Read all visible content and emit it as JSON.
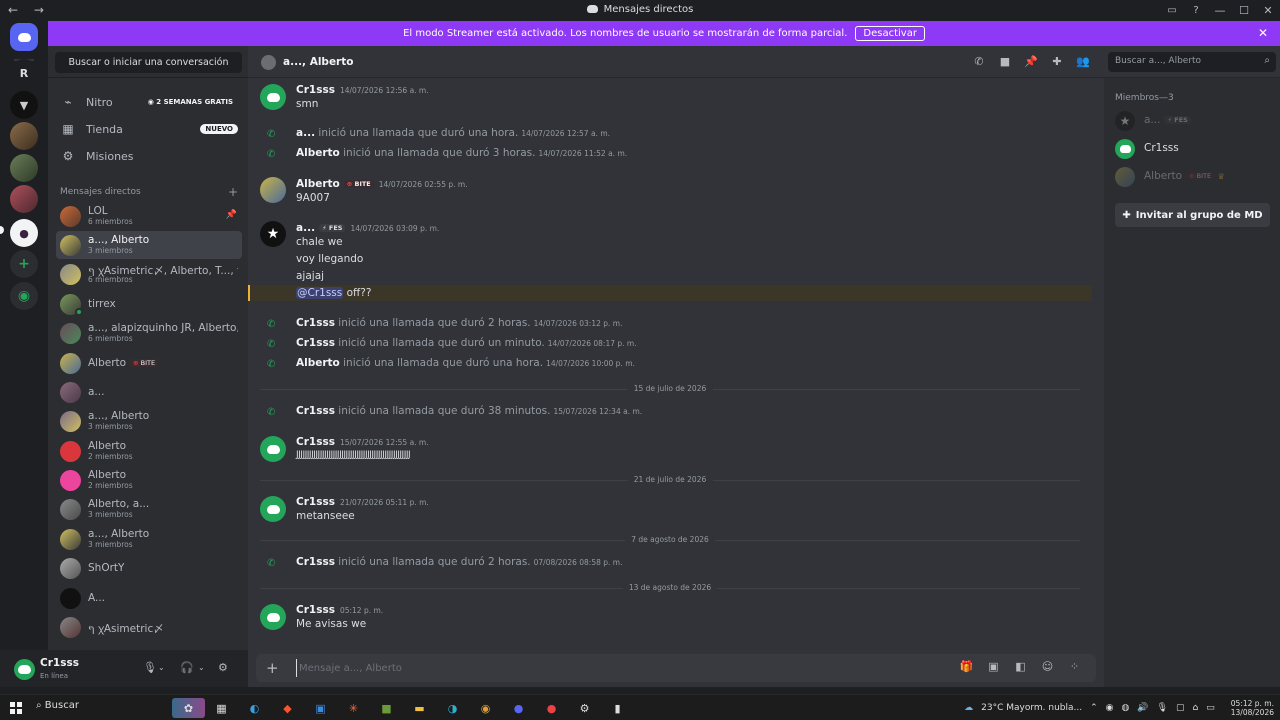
{
  "window": {
    "title": "Mensajes directos"
  },
  "banner": {
    "text": "El modo Streamer está activado. Los nombres de usuario se mostrarán de forma parcial.",
    "button": "Desactivar",
    "color": "#8e39f5"
  },
  "servers": {
    "letter": "R"
  },
  "sidebar": {
    "search_label": "Buscar o iniciar una conversación",
    "nitro": "Nitro",
    "nitro_badge": "2 SEMANAS GRATIS",
    "tienda": "Tienda",
    "tienda_badge": "NUEVO",
    "misiones": "Misiones",
    "section": "Mensajes directos",
    "dms": [
      {
        "name": "LOL",
        "sub": "6 miembros"
      },
      {
        "name": "a..., Alberto",
        "sub": "3 miembros"
      },
      {
        "name": "ף ꭓAsimetric〆, Alberto, T..., ti...",
        "sub": "6 miembros"
      },
      {
        "name": "tirrex",
        "sub": ""
      },
      {
        "name": "a..., alapizquinho JR, Alberto, a...",
        "sub": "6 miembros"
      },
      {
        "name": "Alberto",
        "sub": ""
      },
      {
        "name": "a...",
        "sub": ""
      },
      {
        "name": "a..., Alberto",
        "sub": "3 miembros"
      },
      {
        "name": "Alberto",
        "sub": "2 miembros"
      },
      {
        "name": "Alberto",
        "sub": "2 miembros"
      },
      {
        "name": "Alberto, a...",
        "sub": "3 miembros"
      },
      {
        "name": "a..., Alberto",
        "sub": "3 miembros"
      },
      {
        "name": "ShOrtY",
        "sub": ""
      },
      {
        "name": "A...",
        "sub": ""
      },
      {
        "name": "ף ꭓAsimetric〆",
        "sub": ""
      }
    ],
    "tag_bite": "BITE"
  },
  "user": {
    "name": "Cr1sss",
    "status": "En línea"
  },
  "header": {
    "title": "a..., Alberto",
    "search_placeholder": "Buscar a..., Alberto"
  },
  "messages": {
    "m1_author": "Cr1sss",
    "m1_ts": "14/07/2026 12:56 a. m.",
    "m1_text": "smn",
    "c1_name": "a...",
    "c1_text": "inició una llamada que duró una hora.",
    "c1_ts": "14/07/2026 12:57 a. m.",
    "c2_name": "Alberto",
    "c2_text": "inició una llamada que duró 3 horas.",
    "c2_ts": "14/07/2026 11:52 a. m.",
    "m2_author": "Alberto",
    "m2_tag": "BITE",
    "m2_ts": "14/07/2026 02:55 p. m.",
    "m2_text": "9A007",
    "m3_author": "a...",
    "m3_tag": "FES",
    "m3_ts": "14/07/2026 03:09 p. m.",
    "m3_l1": "chale we",
    "m3_l2": "voy llegando",
    "m3_l3": "ajajaj",
    "m3_mention": "@Cr1sss",
    "m3_l4": "off??",
    "c3_name": "Cr1sss",
    "c3_text": "inició una llamada que duró 2 horas.",
    "c3_ts": "14/07/2026 03:12 p. m.",
    "c4_name": "Cr1sss",
    "c4_text": "inició una llamada que duró un minuto.",
    "c4_ts": "14/07/2026 08:17 p. m.",
    "c5_name": "Alberto",
    "c5_text": "inició una llamada que duró una hora.",
    "c5_ts": "14/07/2026 10:00 p. m.",
    "d1": "15 de julio de 2026",
    "c6_name": "Cr1sss",
    "c6_text": "inició una llamada que duró 38 minutos.",
    "c6_ts": "15/07/2026 12:34 a. m.",
    "m4_author": "Cr1sss",
    "m4_ts": "15/07/2026 12:55 a. m.",
    "m4_text": "JJJJJJJJJJJJJJJJJJJJJJJJJJJJJJJJJJJJJJJJJJJJJJJJJJJJJ",
    "d2": "21 de julio de 2026",
    "m5_author": "Cr1sss",
    "m5_ts": "21/07/2026 05:11 p. m.",
    "m5_text": "metanseee",
    "d3": "7 de agosto de 2026",
    "c7_name": "Cr1sss",
    "c7_text": "inició una llamada que duró 2 horas.",
    "c7_ts": "07/08/2026 08:58 p. m.",
    "d4": "13 de agosto de 2026",
    "m6_author": "Cr1sss",
    "m6_ts": "05:12 p. m.",
    "m6_text": "Me avisas we"
  },
  "composer": {
    "placeholder": "Mensaje a..., Alberto"
  },
  "members": {
    "title": "Miembros—3",
    "m1": "a...",
    "m1_tag": "FES",
    "m2": "Cr1sss",
    "m3": "Alberto",
    "m3_tag": "BITE",
    "invite": "Invitar al grupo de MD"
  },
  "taskbar": {
    "search": "Buscar",
    "weather": "23°C  Mayorm. nubla...",
    "time": "05:12 p. m.",
    "date": "13/08/2026"
  }
}
